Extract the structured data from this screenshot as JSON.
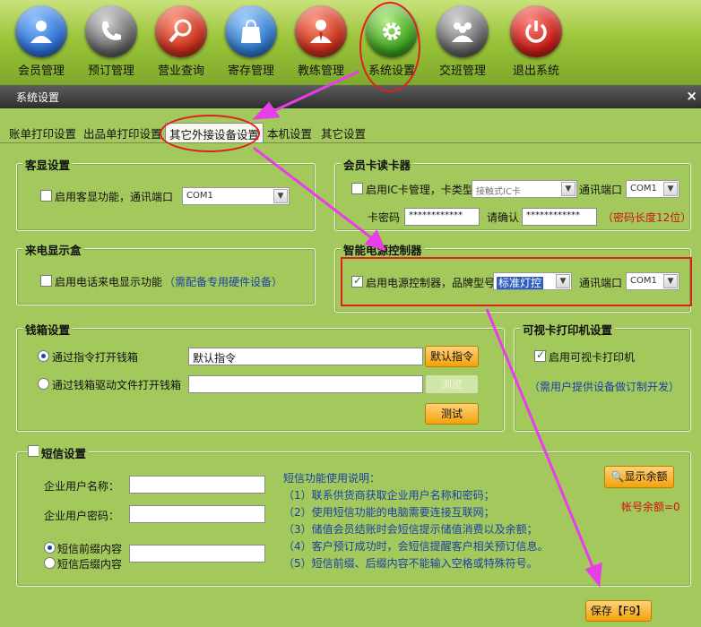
{
  "nav": [
    {
      "id": "member",
      "label": "会员管理",
      "color": "#2f6fd0",
      "icon": "user-icon"
    },
    {
      "id": "booking",
      "label": "预订管理",
      "color": "#555555",
      "icon": "phone-icon"
    },
    {
      "id": "query",
      "label": "营业查询",
      "color": "#c8301c",
      "icon": "magnifier-icon"
    },
    {
      "id": "storage",
      "label": "寄存管理",
      "color": "#2f78c8",
      "icon": "bag-icon"
    },
    {
      "id": "coach",
      "label": "教练管理",
      "color": "#c8301c",
      "icon": "coach-icon"
    },
    {
      "id": "system",
      "label": "系统设置",
      "color": "#3ea020",
      "icon": "gear-icon"
    },
    {
      "id": "shift",
      "label": "交班管理",
      "color": "#555555",
      "icon": "group-icon"
    },
    {
      "id": "exit",
      "label": "退出系统",
      "color": "#c8201c",
      "icon": "power-icon"
    }
  ],
  "window": {
    "title": "系统设置",
    "close": "×"
  },
  "tabs": [
    "账单打印设置",
    "出品单打印设置",
    "其它外接设备设置",
    "本机设置",
    "其它设置"
  ],
  "customer_display": {
    "title": "客显设置",
    "enable_label": "启用客显功能，通讯端口",
    "port": "COM1"
  },
  "card_reader": {
    "title": "会员卡读卡器",
    "enable_label": "启用IC卡管理，卡类型",
    "card_type": "接触式IC卡",
    "port_label": "通讯端口",
    "port": "COM1",
    "pwd_label": "卡密码",
    "pwd_value": "************",
    "confirm_label": "请确认",
    "confirm_value": "************",
    "note": "（密码长度12位）"
  },
  "caller_id": {
    "title": "来电显示盒",
    "enable_label": "启用电话来电显示功能",
    "note": "（需配备专用硬件设备）"
  },
  "power_ctrl": {
    "title": "智能电源控制器",
    "enable_label": "启用电源控制器，品牌型号",
    "model": "标准灯控",
    "port_label": "通讯端口",
    "port": "COM1"
  },
  "cash_drawer": {
    "title": "钱箱设置",
    "opt1": "通过指令打开钱箱",
    "cmd_value": "默认指令",
    "default_btn": "默认指令",
    "opt2": "通过钱箱驱动文件打开钱箱",
    "browse_btn": "浏览",
    "test_btn": "测试"
  },
  "visual_printer": {
    "title": "可视卡打印机设置",
    "enable_label": "启用可视卡打印机",
    "note": "（需用户提供设备做订制开发）"
  },
  "sms": {
    "title": "短信设置",
    "user_label": "企业用户名称：",
    "pwd_label": "企业用户密码：",
    "prefix_label": "短信前缀内容",
    "suffix_label": "短信后缀内容",
    "help_title": "短信功能使用说明：",
    "help": [
      "（1）联系供货商获取企业用户名称和密码；",
      "（2）使用短信功能的电脑需要连接互联网；",
      "（3）储值会员结账时会短信提示储值消费以及余额；",
      "（4）客户预订成功时，会短信提醒客户相关预订信息。",
      "（5）短信前缀、后缀内容不能输入空格或特殊符号。"
    ],
    "balance_btn": "显示余额",
    "balance_text": "帐号余额=0"
  },
  "save_btn": "保存【F9】"
}
